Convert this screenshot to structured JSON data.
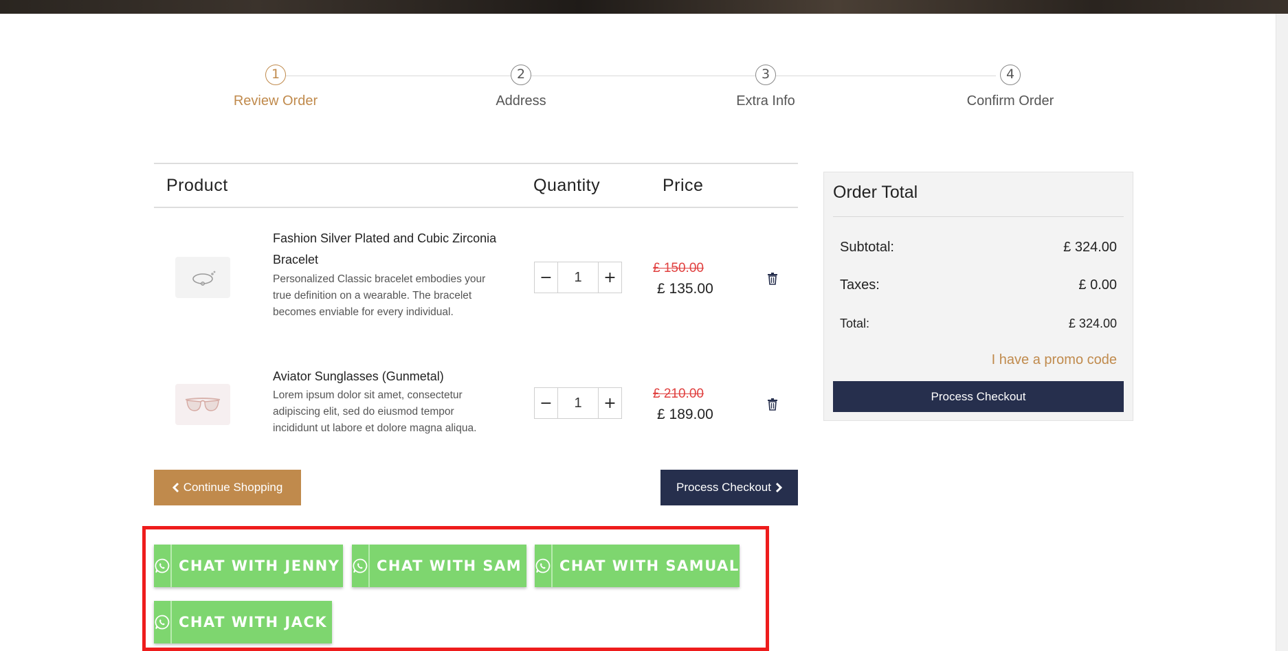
{
  "steps": [
    {
      "number": "1",
      "label": "Review Order",
      "active": true
    },
    {
      "number": "2",
      "label": "Address",
      "active": false
    },
    {
      "number": "3",
      "label": "Extra Info",
      "active": false
    },
    {
      "number": "4",
      "label": "Confirm Order",
      "active": false
    }
  ],
  "cart": {
    "headers": {
      "product": "Product",
      "quantity": "Quantity",
      "price": "Price"
    },
    "items": [
      {
        "name": "Fashion Silver Plated and Cubic Zirconia Bracelet",
        "description": "Personalized Classic bracelet embodies your true definition on a wearable. The bracelet becomes enviable for every individual.",
        "quantity": "1",
        "old_price": "£ 150.00",
        "price": "£ 135.00",
        "thumb_icon": "bracelet-icon"
      },
      {
        "name": "Aviator Sunglasses (Gunmetal)",
        "description": "Lorem ipsum dolor sit amet, consectetur adipiscing elit, sed do eiusmod tempor incididunt ut labore et dolore magna aliqua.",
        "quantity": "1",
        "old_price": "£ 210.00",
        "price": "£ 189.00",
        "thumb_icon": "sunglasses-icon"
      }
    ],
    "qty_minus": "−",
    "qty_plus": "+",
    "continue_label": "Continue Shopping",
    "process_label": "Process Checkout"
  },
  "order_total": {
    "title": "Order Total",
    "subtotal_label": "Subtotal:",
    "subtotal_value": "£ 324.00",
    "taxes_label": "Taxes:",
    "taxes_value": "£ 0.00",
    "total_label": "Total:",
    "total_value": "£ 324.00",
    "promo_label": "I have a promo code",
    "process_label": "Process Checkout"
  },
  "chat": {
    "buttons": [
      {
        "label": "CHAT WITH JENNY"
      },
      {
        "label": "CHAT WITH SAM"
      },
      {
        "label": "CHAT WITH SAMUAL"
      },
      {
        "label": "CHAT WITH JACK"
      }
    ],
    "icon": "whatsapp-icon"
  },
  "colors": {
    "accent": "#c08a4c",
    "navy": "#262f4d",
    "whatsapp_green": "#7ed66f",
    "strike_red": "#e0403f",
    "highlight_red": "#ee1c1c"
  }
}
